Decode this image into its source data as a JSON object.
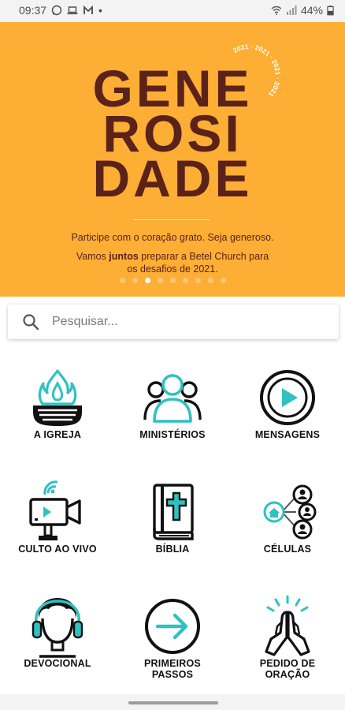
{
  "status_bar": {
    "time": "09:37",
    "dot": "•",
    "battery": "44%",
    "left_icons": [
      "whatsapp-icon",
      "laptop-icon",
      "m-app-icon"
    ],
    "right_icons": [
      "wifi-icon",
      "signal-icon",
      "battery-icon"
    ]
  },
  "banner": {
    "title_lines": [
      "GENE",
      "ROSI",
      "DADE"
    ],
    "year_ring": "2021 · 2021 · 2021 · 2021",
    "line1": "Participe com o coração grato. Seja generoso.",
    "line2_pre": "Vamos ",
    "line2_bold": "juntos",
    "line2_post": " preparar a Betel Church para",
    "line3": "os desafios de 2021.",
    "carousel": {
      "total": 9,
      "active_index": 2
    },
    "colors": {
      "background": "#fdae35",
      "text": "#5b2219"
    }
  },
  "search": {
    "placeholder": "Pesquisar...",
    "value": ""
  },
  "menu": {
    "accent_color": "#2fc1c1",
    "items": [
      {
        "label": "A IGREJA",
        "icon": "flame-icon"
      },
      {
        "label": "MINISTÉRIOS",
        "icon": "people-icon"
      },
      {
        "label": "MENSAGENS",
        "icon": "play-circle-icon"
      },
      {
        "label": "CULTO AO VIVO",
        "icon": "video-camera-icon"
      },
      {
        "label": "BÍBLIA",
        "icon": "bible-icon"
      },
      {
        "label": "CÉLULAS",
        "icon": "cells-network-icon"
      },
      {
        "label": "DEVOCIONAL",
        "icon": "headphones-person-icon"
      },
      {
        "label": "PRIMEIROS PASSOS",
        "line1": "PRIMEIROS",
        "line2": "PASSOS",
        "icon": "arrow-circle-icon"
      },
      {
        "label": "PEDIDO DE ORAÇÃO",
        "line1": "PEDIDO DE",
        "line2": "ORAÇÃO",
        "icon": "praying-hands-icon"
      }
    ]
  }
}
